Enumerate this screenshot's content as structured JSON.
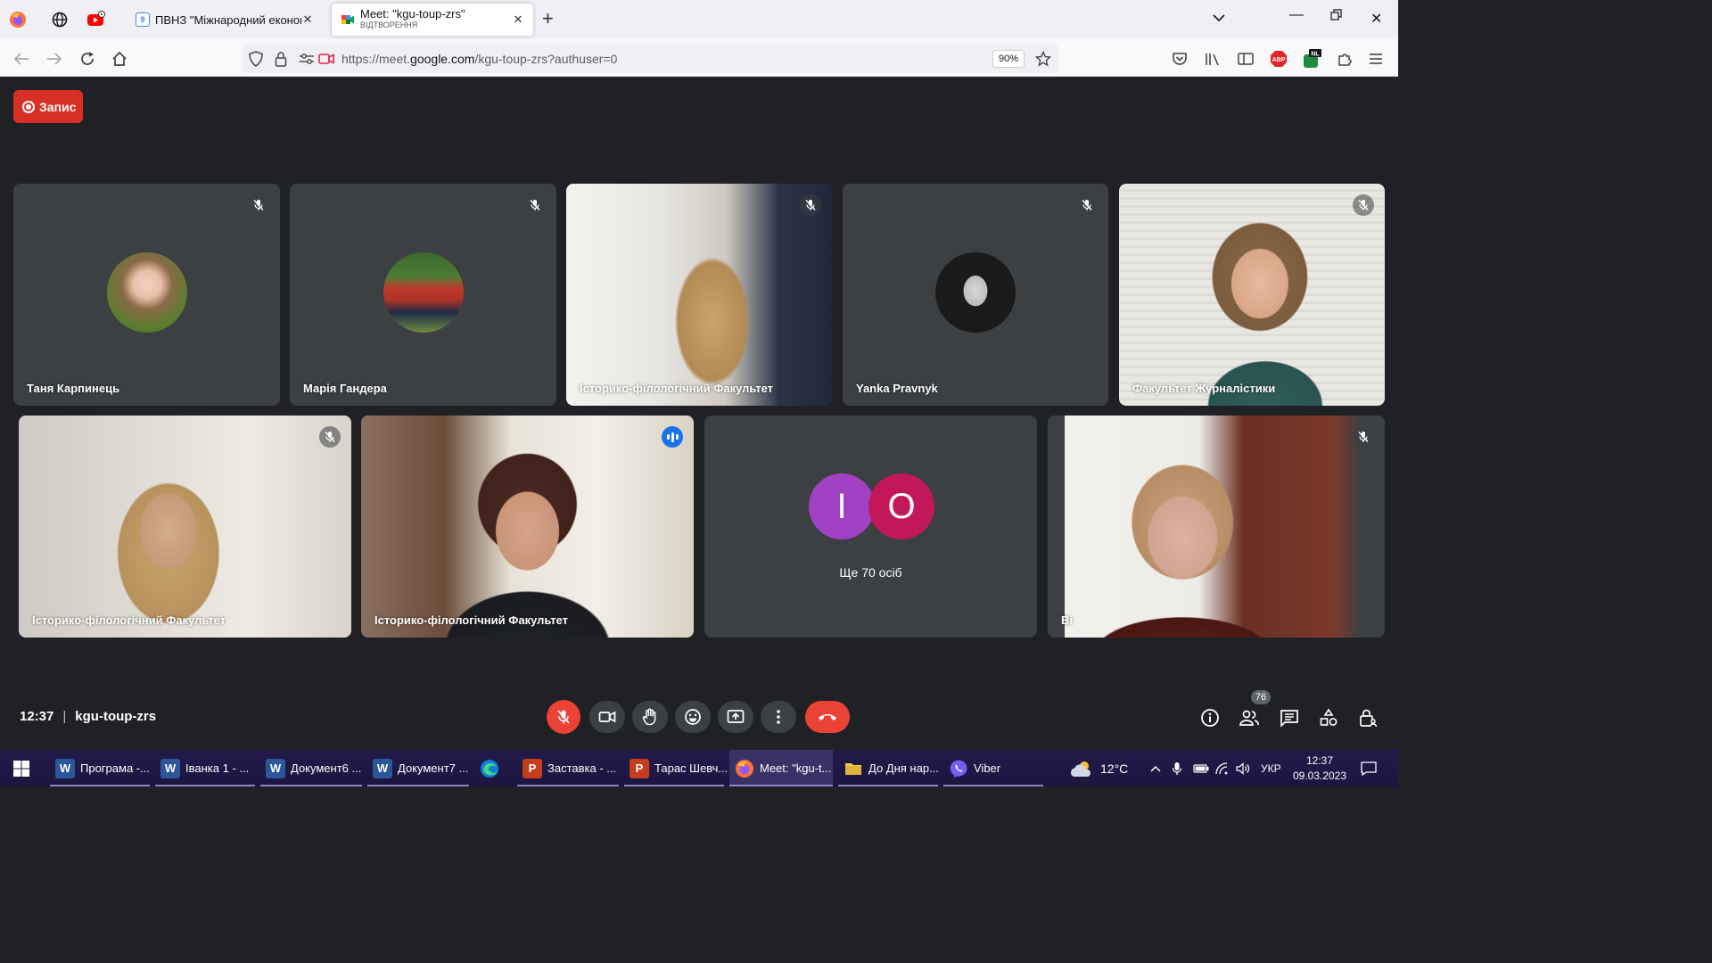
{
  "browser": {
    "tabs": [
      {
        "title": "ПВНЗ \"Міжнародний економі",
        "active": false
      },
      {
        "title": "Meet: \"kgu-toup-zrs\"",
        "subtitle": "ВІДТВОРЕННЯ",
        "active": true
      }
    ],
    "url_scheme": "https://meet.",
    "url_host": "google.com",
    "url_path": "/kgu-toup-zrs?authuser=0",
    "zoom": "90%",
    "abp_label": "ABP",
    "nl_label": "NL"
  },
  "meet": {
    "record_label": "Запис",
    "participants": [
      {
        "name": "Таня Карпинець",
        "muted": true,
        "type": "avatar"
      },
      {
        "name": "Марія Гандера",
        "muted": true,
        "type": "avatar"
      },
      {
        "name": "Історико-філологічний Факультет",
        "muted": true,
        "type": "video"
      },
      {
        "name": "Yanka Pravnyk",
        "muted": true,
        "type": "avatar"
      },
      {
        "name": "Факультет Журналістики",
        "muted": true,
        "type": "video"
      },
      {
        "name": "Історико-філологічний Факультет",
        "muted": true,
        "type": "video"
      },
      {
        "name": "Історико-філологічний Факультет",
        "muted": false,
        "speaking": true,
        "type": "video"
      },
      {
        "name": "Ві",
        "muted": true,
        "type": "video"
      }
    ],
    "others": {
      "initials": [
        "І",
        "О"
      ],
      "colors": [
        "#a142c4",
        "#c2185b"
      ],
      "label": "Ще 70 осіб"
    },
    "time": "12:37",
    "meeting_code": "kgu-toup-zrs",
    "participant_count": "76"
  },
  "taskbar": {
    "items": [
      {
        "label": "Програма -...",
        "icon": "word-icon",
        "color": "#2b579a",
        "letter": "W"
      },
      {
        "label": "Іванка 1 - ...",
        "icon": "word-icon",
        "color": "#2b579a",
        "letter": "W"
      },
      {
        "label": "Документ6 ...",
        "icon": "word-icon",
        "color": "#2b579a",
        "letter": "W"
      },
      {
        "label": "Документ7 ...",
        "icon": "word-icon",
        "color": "#2b579a",
        "letter": "W"
      },
      {
        "label": "Заставка - ...",
        "icon": "powerpoint-icon",
        "color": "#c43e1c",
        "letter": "P"
      },
      {
        "label": "Тарас Шевч...",
        "icon": "powerpoint-icon",
        "color": "#c43e1c",
        "letter": "P"
      },
      {
        "label": "Meet: \"kgu-t...",
        "icon": "firefox-icon",
        "color": "#ff7139",
        "letter": ""
      },
      {
        "label": "До Дня нар...",
        "icon": "folder-icon",
        "color": "#f2c94c",
        "letter": ""
      },
      {
        "label": "Viber",
        "icon": "viber-icon",
        "color": "#7360f2",
        "letter": ""
      }
    ],
    "weather": "12°C",
    "language": "УКР",
    "time": "12:37",
    "date": "09.03.2023"
  }
}
